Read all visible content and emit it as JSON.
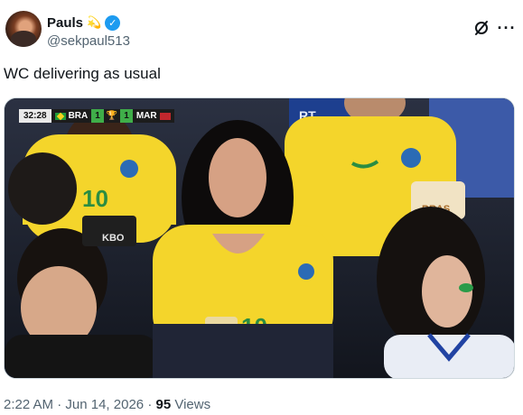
{
  "author": {
    "name": "Pauls",
    "badge_emoji": "💫",
    "handle": "@sekpaul513",
    "verified": true,
    "verified_color": "#1d9bf0"
  },
  "actions": {
    "grok_icon": "grok-slash-circle-icon",
    "more_label": "···"
  },
  "tweet": {
    "text": "WC delivering as usual"
  },
  "media": {
    "scoreboard": {
      "time": "32:28",
      "team_home": "BRA",
      "score_home": "1",
      "score_away": "1",
      "team_away": "MAR",
      "score_color": "#3fae49"
    },
    "banner_text": "RT",
    "cup_text": "BRAS",
    "sign_text": "KBO",
    "jersey_number": "10"
  },
  "footer": {
    "time": "2:22 AM",
    "separator": "·",
    "date": "Jun 14, 2026",
    "views_count": "95",
    "views_label": "Views"
  }
}
